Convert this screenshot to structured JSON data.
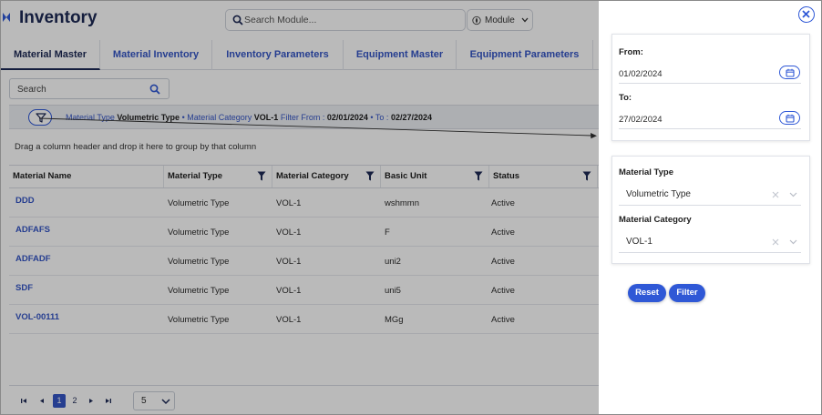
{
  "app": {
    "title": "Inventory",
    "search_placeholder": "Search Module...",
    "module_label": "Module"
  },
  "tabs": [
    {
      "label": "Material Master",
      "active": true
    },
    {
      "label": "Material Inventory",
      "active": false
    },
    {
      "label": "Inventory Parameters",
      "active": false
    },
    {
      "label": "Equipment Master",
      "active": false
    },
    {
      "label": "Equipment Parameters",
      "active": false
    }
  ],
  "grid": {
    "search_placeholder": "Search",
    "group_hint": "Drag a column header and drop it here to group by that column",
    "applied_filters": {
      "material_type_key": "Material Type",
      "material_type_value": "Volumetric Type",
      "material_category_key": "Material Category",
      "material_category_value": "VOL-1",
      "filter_from_key": "Filter From :",
      "filter_from_value": "02/01/2024",
      "to_key": "To :",
      "to_value": "02/27/2024",
      "separator": "•"
    },
    "columns": [
      "Material Name",
      "Material Type",
      "Material Category",
      "Basic Unit",
      "Status"
    ],
    "rows": [
      [
        "DDD",
        "Volumetric Type",
        "VOL-1",
        "wshmmn",
        "Active"
      ],
      [
        "ADFAFS",
        "Volumetric Type",
        "VOL-1",
        "F",
        "Active"
      ],
      [
        "ADFADF",
        "Volumetric Type",
        "VOL-1",
        "uni2",
        "Active"
      ],
      [
        "SDF",
        "Volumetric Type",
        "VOL-1",
        "uni5",
        "Active"
      ],
      [
        "VOL-00111",
        "Volumetric Type",
        "VOL-1",
        "MGg",
        "Active"
      ]
    ],
    "pager": {
      "pages": [
        "1",
        "2"
      ],
      "current_page": "1",
      "page_size": "5"
    }
  },
  "filter_panel": {
    "from_label": "From:",
    "from_value": "01/02/2024",
    "to_label": "To:",
    "to_value": "27/02/2024",
    "material_type_label": "Material Type",
    "material_type_value": "Volumetric Type",
    "material_category_label": "Material Category",
    "material_category_value": "VOL-1",
    "reset_label": "Reset",
    "filter_label": "Filter"
  },
  "colors": {
    "accent": "#2f58d6",
    "title": "#1e2a55",
    "link": "#3556c6",
    "overlay": "rgba(0,0,0,0.27)"
  },
  "icons": [
    "collapse-icon",
    "search-icon",
    "module-icon",
    "chevron-down-icon",
    "filter-icon",
    "funnel-icon",
    "first-page-icon",
    "prev-page-icon",
    "next-page-icon",
    "last-page-icon",
    "close-icon",
    "calendar-icon",
    "clear-icon"
  ]
}
